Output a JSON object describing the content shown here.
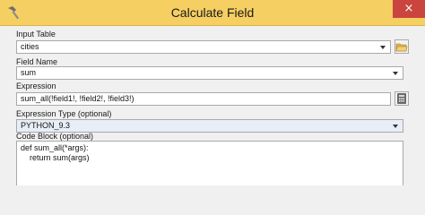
{
  "window": {
    "title": "Calculate Field",
    "close_label": "×"
  },
  "input_table": {
    "label": "Input Table",
    "value": "cities",
    "icon": "open-folder-icon"
  },
  "field_name": {
    "label": "Field Name",
    "value": "sum"
  },
  "expression": {
    "label": "Expression",
    "value": "sum_all(!field1!, !field2!, !field3!)",
    "icon": "calculator-icon"
  },
  "expression_type": {
    "label": "Expression Type (optional)",
    "value": "PYTHON_9.3"
  },
  "code_block": {
    "label": "Code Block (optional)",
    "lines": [
      "def sum_all(*args):",
      "    return sum(args)"
    ]
  },
  "colors": {
    "title_bar": "#f5cf62",
    "close_button": "#c9453d"
  }
}
